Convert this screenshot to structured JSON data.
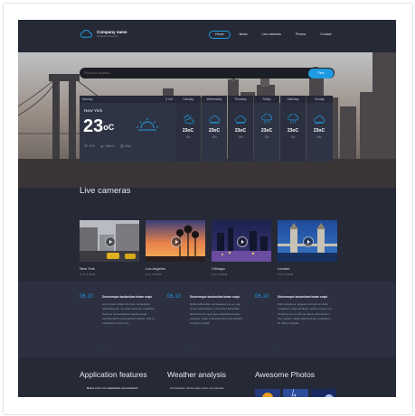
{
  "header": {
    "logo_name": "Company name",
    "logo_tagline": "Optimized tag line",
    "nav": [
      {
        "label": "Home",
        "active": true
      },
      {
        "label": "News",
        "active": false
      },
      {
        "label": "Live cameras",
        "active": false
      },
      {
        "label": "Photos",
        "active": false
      },
      {
        "label": "Contact",
        "active": false
      }
    ]
  },
  "search": {
    "placeholder": "Find your location...",
    "button_label": "Find"
  },
  "today": {
    "day": "Monday",
    "date": "6 Oct",
    "city": "New York",
    "temp": "23",
    "unit": "oC",
    "humidity": "20%",
    "wind": "18km/h",
    "direction": "East"
  },
  "forecast": [
    {
      "day": "Tuesday",
      "hi": "23oC",
      "lo": "18o",
      "icon": "partly-sunny-icon"
    },
    {
      "day": "Wednesday",
      "hi": "23oC",
      "lo": "18o",
      "icon": "cloud-icon"
    },
    {
      "day": "Thursday",
      "hi": "23oC",
      "lo": "18o",
      "icon": "cloud-icon"
    },
    {
      "day": "Friday",
      "hi": "23oC",
      "lo": "18o",
      "icon": "rain-cloud-icon"
    },
    {
      "day": "Saturday",
      "hi": "23oC",
      "lo": "18o",
      "icon": "rain-cloud-icon"
    },
    {
      "day": "Sunday",
      "hi": "23oC",
      "lo": "18o",
      "icon": "cloud-icon"
    }
  ],
  "live_cameras": {
    "title": "Live cameras",
    "items": [
      {
        "city": "New York",
        "date": "8 oct, 8:00AM"
      },
      {
        "city": "Los Angeles",
        "date": "8 oct, 8:00AM"
      },
      {
        "city": "Chicago",
        "date": "8 oct, 8:00AM"
      },
      {
        "city": "London",
        "date": "8 oct, 8:00AM"
      }
    ]
  },
  "news": [
    {
      "date": "06.10",
      "title": "Doloremque laudantium totam sequi",
      "body": "Lorem ipsum dolor sit amet, consectetur adipisicing elit. Vo lupas ducimus cupiditate ducimus necessitatibus repellat quod reprehenderit necessitatibus aliquid, nihil ut voluptatum minus iure.",
      "more": "..."
    },
    {
      "date": "06.10",
      "title": "Doloremque laudantium totam sequi",
      "body": "Nobis quibusdam consequatur ea, ex, quo ipsum voluptatibus, nihil quae? Molestias doloribus cum quis qua, dignissimos dolor voluptas. Fuga, molestiae libero perspiciatis corporis repellat.",
      "more": "..."
    },
    {
      "date": "06.10",
      "title": "Doloremque laudantium totam sequi",
      "body": "Enim possimus, aliquam corrupti rat. Enim voluptatem alias similique, nostrum fuga mox. Tempora rerum velit vel natus. Laboriosam iste, quidem fugiat eligendi quae voluptatem sit natus voluptas.",
      "more": "..."
    }
  ],
  "bottom": {
    "col1_title": "Application features",
    "col1_item": "Natus error sit voluptatem accusantium",
    "col2_title": "Weather analysis",
    "col2_item": "Accusantium doloremque totam rem aperiam",
    "col3_title": "Awesome Photos"
  },
  "colors": {
    "background": "#262936",
    "panel": "#2f3445",
    "accent": "#1e9be0",
    "news_band": "#2c3040"
  }
}
